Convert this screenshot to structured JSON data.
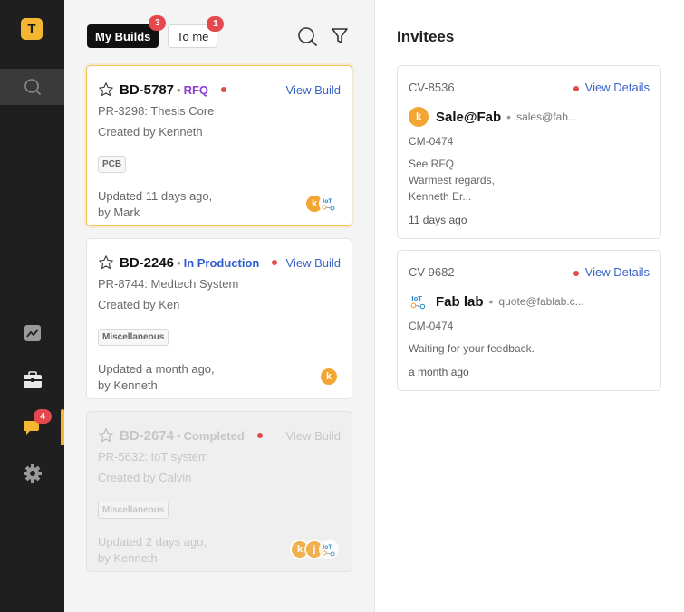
{
  "sidebar": {
    "logo_letter": "T",
    "chat_badge": "4"
  },
  "tabs": [
    {
      "label": "My Builds",
      "badge": "3"
    },
    {
      "label": "To me",
      "badge": "1"
    }
  ],
  "builds": [
    {
      "id": "BD-5787",
      "status": "RFQ",
      "view_label": "View Build",
      "project": "PR-3298: Thesis Core",
      "created": "Created by Kenneth",
      "tag": "PCB",
      "updated_line1": "Updated 11 days ago,",
      "updated_line2": "by Mark",
      "avatar1": "k"
    },
    {
      "id": "BD-2246",
      "status": "In Production",
      "view_label": "View Build",
      "project": "PR-8744: Medtech System",
      "created": "Created by Ken",
      "tag": "Miscellaneous",
      "updated_line1": "Updated a month ago,",
      "updated_line2": "by Kenneth",
      "avatar1": "k"
    },
    {
      "id": "BD-2674",
      "status": "Completed",
      "view_label": "View Build",
      "project": "PR-5632: IoT system",
      "created": "Created by Calvin",
      "tag": "Miscellaneous",
      "updated_line1": "Updated 2 days ago,",
      "updated_line2": "by Kenneth",
      "avatar1": "k",
      "avatar2": "j"
    }
  ],
  "invitees": {
    "title": "Invitees",
    "items": [
      {
        "id": "CV-8536",
        "view_label": "View Details",
        "avatar": "k",
        "name": "Sale@Fab",
        "email": "sales@fab...",
        "code": "CM-0474",
        "message_line1": "See RFQ",
        "message_line2": "Warmest regards,",
        "message_line3": "Kenneth Er...",
        "time": "11 days ago"
      },
      {
        "id": "CV-9682",
        "view_label": "View Details",
        "name": "Fab lab",
        "email": "quote@fablab.c...",
        "code": "CM-0474",
        "message_line1": "Waiting for your feedback.",
        "time": "a month ago"
      }
    ]
  },
  "colors": {
    "accent": "#f5b731",
    "badge": "#e5484d",
    "link": "#3a63c9",
    "rfq": "#8a3ccf",
    "in_production": "#2f5ccf"
  }
}
